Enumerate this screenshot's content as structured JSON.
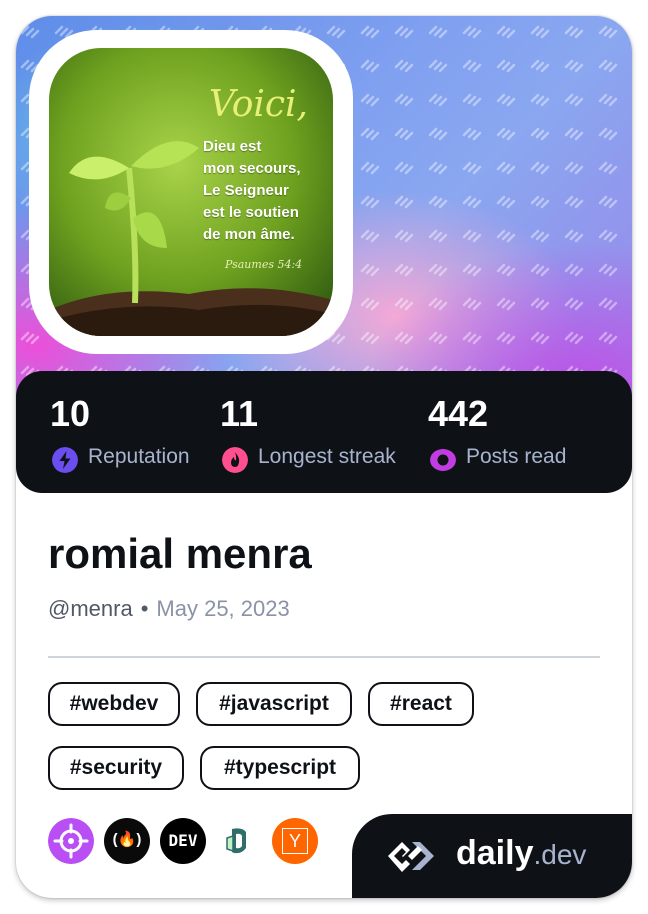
{
  "avatar": {
    "quote_title": "Voici,",
    "quote_lines": [
      "Dieu est",
      "mon secours,",
      "Le Seigneur",
      "est le soutien",
      "de mon âme."
    ],
    "quote_ref": "Psaumes 54:4"
  },
  "stats": [
    {
      "value": "10",
      "label": "Reputation",
      "icon": "lightning-icon",
      "color": "#6b4ef0"
    },
    {
      "value": "11",
      "label": "Longest streak",
      "icon": "flame-icon",
      "color": "#ff4f8f"
    },
    {
      "value": "442",
      "label": "Posts read",
      "icon": "eye-ring-icon",
      "color": "#c03de0"
    }
  ],
  "profile": {
    "name": "romial menra",
    "handle": "@menra",
    "separator": "•",
    "joined": "May 25, 2023"
  },
  "tags": [
    "#webdev",
    "#javascript",
    "#react",
    "#security",
    "#typescript"
  ],
  "badges": [
    {
      "name": "crosshair-badge-icon",
      "color": "#b94ef5"
    },
    {
      "name": "freecodecamp-badge-icon",
      "color": "#0a0a23",
      "text": "(🔥)"
    },
    {
      "name": "dev-badge-icon",
      "color": "#000000",
      "text": "DEV"
    },
    {
      "name": "hashnode-badge-icon",
      "color": "#ffffff"
    },
    {
      "name": "ycombinator-badge-icon",
      "color": "#ff6600",
      "text": "Y"
    }
  ],
  "brand": {
    "name": "daily",
    "suffix": ".dev"
  }
}
